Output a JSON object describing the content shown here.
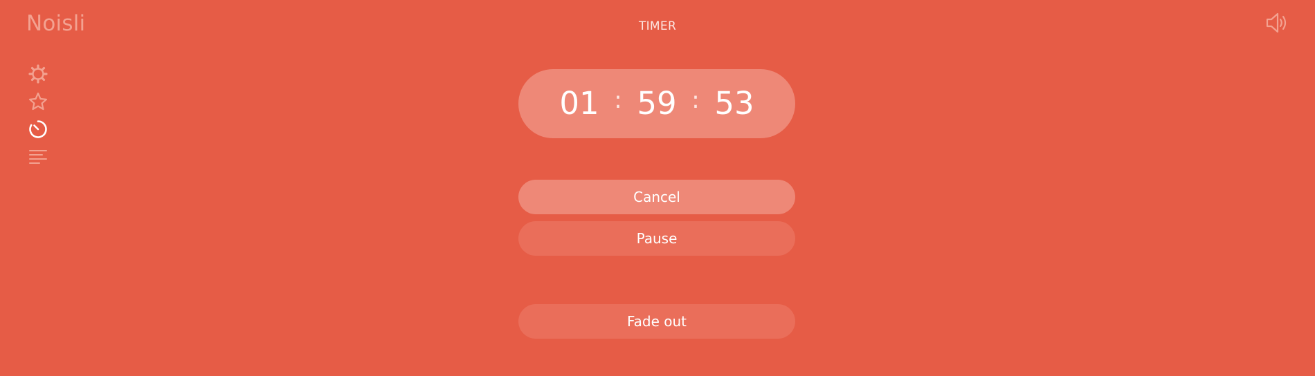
{
  "app": {
    "logo": "Noisli",
    "title": "TIMER"
  },
  "header": {
    "volume_icon": "speaker-icon"
  },
  "sidebar": {
    "items": [
      {
        "icon": "gear-icon",
        "active": false
      },
      {
        "icon": "star-icon",
        "active": false
      },
      {
        "icon": "timer-icon",
        "active": true
      },
      {
        "icon": "text-lines-icon",
        "active": false
      }
    ]
  },
  "timer": {
    "hours": "01",
    "minutes": "59",
    "seconds": "53",
    "separator": ":"
  },
  "buttons": {
    "cancel": "Cancel",
    "pause": "Pause",
    "fade_out": "Fade out"
  },
  "colors": {
    "background": "#e65c46",
    "timer_box": "#ee8877",
    "button_secondary": "#ea6e5a",
    "icon_muted": "#f3a291",
    "icon_active": "#ffffff"
  }
}
